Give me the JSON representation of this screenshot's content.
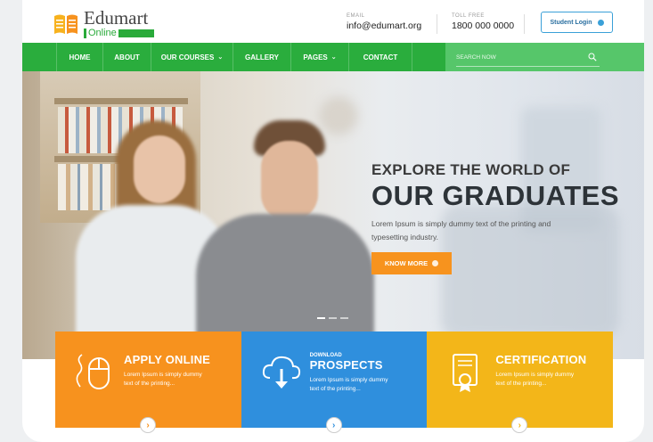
{
  "brand": {
    "name": "Edumart",
    "sub": "Online"
  },
  "header": {
    "email_label": "EMAIL",
    "email": "info@edumart.org",
    "phone_label": "TOLL FREE",
    "phone": "1800 000 0000",
    "login_label": "Student Login"
  },
  "nav": {
    "items": [
      "HOME",
      "ABOUT",
      "OUR COURSES",
      "GALLERY",
      "PAGES",
      "CONTACT"
    ],
    "search_placeholder": "SEARCH NOW"
  },
  "hero": {
    "subtitle": "EXPLORE THE WORLD OF",
    "title": "OUR GRADUATES",
    "description": "Lorem Ipsum is simply dummy text of the printing and typesetting industry.",
    "button": "KNOW MORE",
    "slides": 3,
    "active_slide": 1
  },
  "features": [
    {
      "small": "",
      "title": "APPLY ONLINE",
      "desc": "Lorem Ipsum is simply dummy text of the printing...",
      "color": "#f7921e",
      "icon": "mouse-icon"
    },
    {
      "small": "DOWNLOAD",
      "title": "PROSPECTS",
      "desc": "Lorem Ipsum is simply dummy text of the printing...",
      "color": "#2f8fdd",
      "icon": "cloud-download-icon"
    },
    {
      "small": "",
      "title": "CERTIFICATION",
      "desc": "Lorem Ipsum is simply dummy text of the printing...",
      "color": "#f3b619",
      "icon": "certificate-icon"
    }
  ],
  "colors": {
    "primary_green": "#2aad3d",
    "accent_orange": "#f7931e",
    "accent_blue": "#2f8fdd",
    "accent_yellow": "#f3b619"
  }
}
